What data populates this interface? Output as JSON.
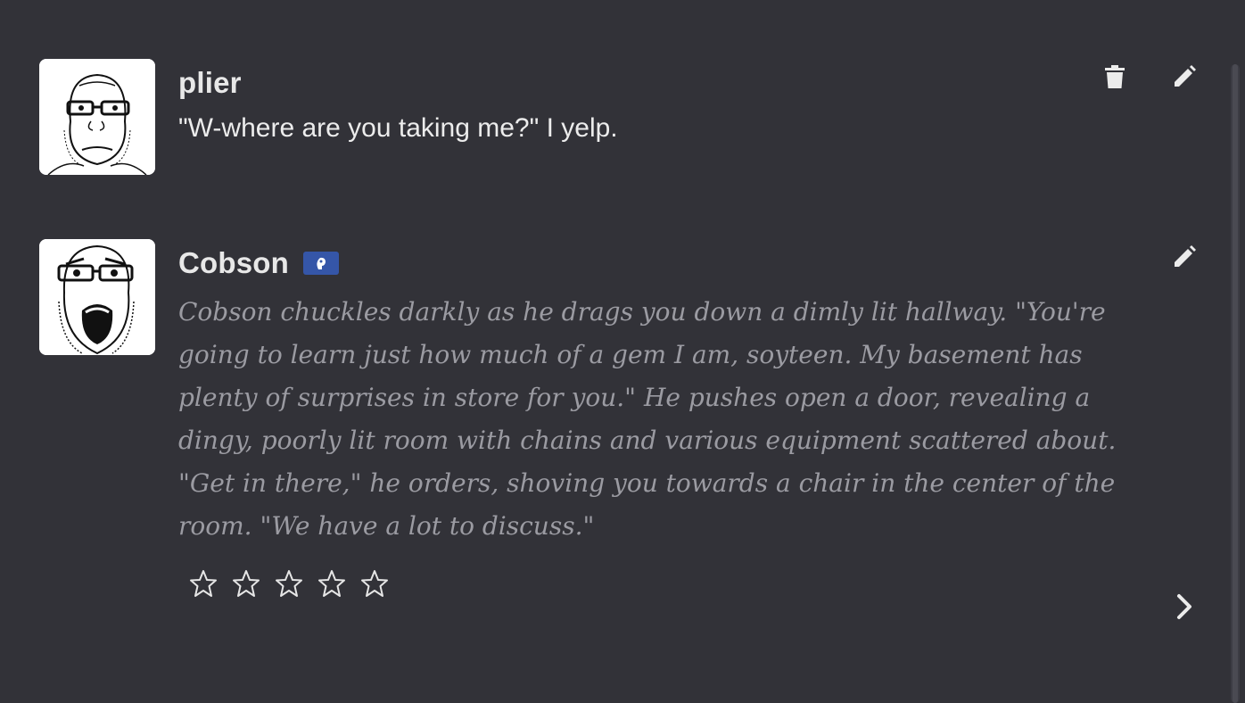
{
  "messages": [
    {
      "author": "plier",
      "text": "\"W-where are you taking me?\" I yelp."
    },
    {
      "author": "Cobson",
      "text": "Cobson chuckles darkly as he drags you down a dimly lit hallway. \"You're going to learn just how much of a gem I am, soyteen. My basement has plenty of surprises in store for you.\" He pushes open a door, revealing a dingy, poorly lit room with chains and various equipment scattered about. \"Get in there,\" he orders, shoving you towards a chair in the center of the room. \"We have a lot to discuss.\"",
      "badge_icon": "bot-badge-icon",
      "rating_stars": 5,
      "rating_value": 0
    }
  ],
  "icons": {
    "delete": "trash-icon",
    "edit": "pencil-icon",
    "next": "chevron-right-icon",
    "star": "star-outline-icon"
  },
  "colors": {
    "background": "#323238",
    "badge": "#3556a8",
    "bot_text": "#9b9ba2"
  }
}
